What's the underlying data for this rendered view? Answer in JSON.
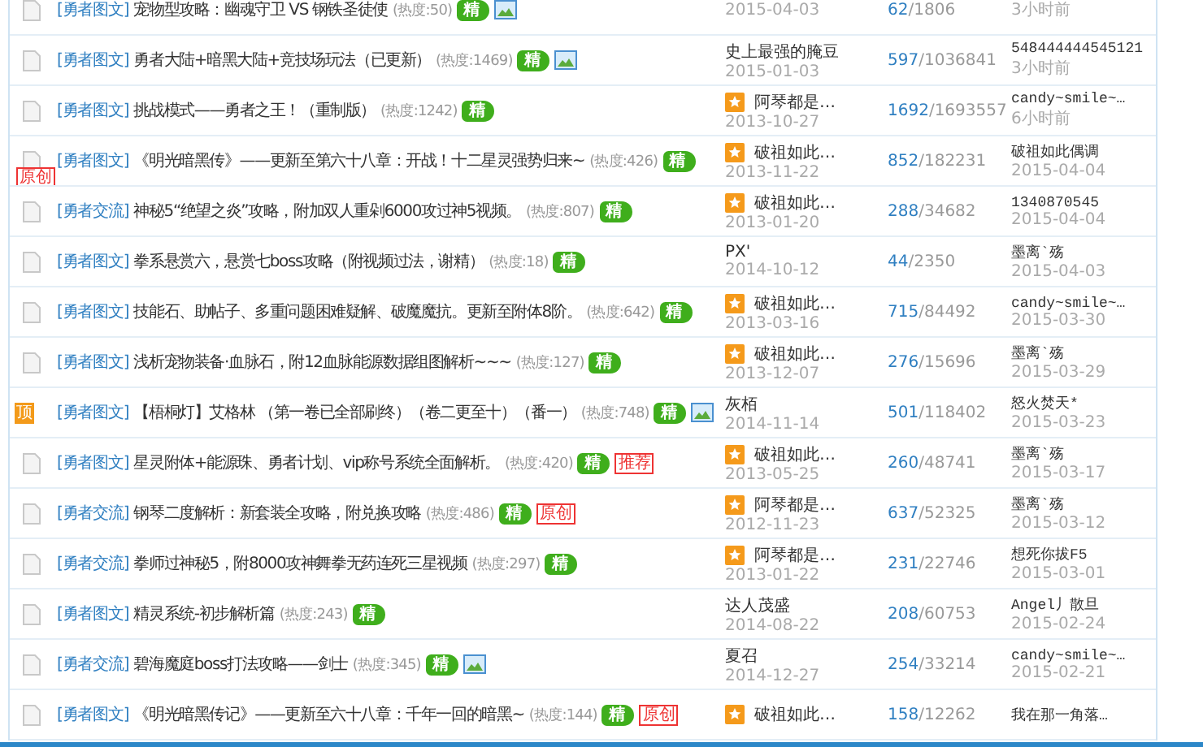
{
  "rows": [
    {
      "icon": {
        "kind": "doc"
      },
      "tag": "[勇者图文]",
      "title": "宠物型攻略：幽魂守卫 VS 钢铁圣徒使",
      "heat": "(热度:50)",
      "badges": [
        {
          "kind": "jing",
          "label": "精"
        },
        {
          "kind": "image"
        }
      ],
      "author": {
        "star": false
      },
      "created": "2015-04-03",
      "replies": "62",
      "views": "/1806",
      "last_time": "3小时前"
    },
    {
      "icon": {
        "kind": "doc"
      },
      "tag": "[勇者图文]",
      "title": "勇者大陆+暗黑大陆+竞技场玩法（已更新）",
      "heat": "(热度:1469)",
      "badges": [
        {
          "kind": "jing",
          "label": "精"
        },
        {
          "kind": "image"
        }
      ],
      "author": {
        "name": "史上最强的腌豆",
        "star": false
      },
      "created": "2015-01-03",
      "replies": "597",
      "views": "/1036841",
      "last_user": "548444444545121",
      "last_time": "3小时前"
    },
    {
      "icon": {
        "kind": "doc"
      },
      "tag": "[勇者图文]",
      "title": "挑战模式——勇者之王！（重制版）",
      "heat": "(热度:1242)",
      "badges": [
        {
          "kind": "jing",
          "label": "精"
        }
      ],
      "author": {
        "name": "阿琴都是…",
        "star": true
      },
      "created": "2013-10-27",
      "replies": "1692",
      "views": "/1693557",
      "last_user": "candy~smile~…",
      "last_time": "6小时前"
    },
    {
      "icon": {
        "kind": "doc"
      },
      "side_stamp": "原创",
      "tag": "[勇者图文]",
      "title": "《明光暗黑传》——更新至第六十八章：开战！十二星灵强势归来~",
      "heat": "(热度:426)",
      "badges": [
        {
          "kind": "jing",
          "label": "精"
        }
      ],
      "author": {
        "name": "破祖如此…",
        "star": true
      },
      "created": "2013-11-22",
      "replies": "852",
      "views": "/182231",
      "last_user": "破祖如此偶调",
      "last_time": "2015-04-04"
    },
    {
      "icon": {
        "kind": "doc"
      },
      "tag": "[勇者交流]",
      "title": "神秘5“绝望之炎”攻略，附加双人重剁6000攻过神5视频。",
      "heat": "(热度:807)",
      "badges": [
        {
          "kind": "jing",
          "label": "精"
        }
      ],
      "author": {
        "name": "破祖如此…",
        "star": true
      },
      "created": "2013-01-20",
      "replies": "288",
      "views": "/34682",
      "last_user": "1340870545",
      "last_time": "2015-04-04"
    },
    {
      "icon": {
        "kind": "doc"
      },
      "tag": "[勇者图文]",
      "title": "拳系悬赏六，悬赏七boss攻略（附视频过法，谢精）",
      "heat": "(热度:18)",
      "badges": [
        {
          "kind": "jing",
          "label": "精"
        }
      ],
      "author": {
        "name": "PX'",
        "star": false
      },
      "created": "2014-10-12",
      "replies": "44",
      "views": "/2350",
      "last_user": "墨离`殇",
      "last_time": "2015-04-03"
    },
    {
      "icon": {
        "kind": "doc"
      },
      "tag": "[勇者图文]",
      "title": "技能石、助帖子、多重问题困难疑解、破魔魔抗。更新至附体8阶。",
      "heat": "(热度:642)",
      "badges": [
        {
          "kind": "jing",
          "label": "精"
        }
      ],
      "author": {
        "name": "破祖如此…",
        "star": true
      },
      "created": "2013-03-16",
      "replies": "715",
      "views": "/84492",
      "last_user": "candy~smile~…",
      "last_time": "2015-03-30"
    },
    {
      "icon": {
        "kind": "doc"
      },
      "tag": "[勇者图文]",
      "title": "浅析宠物装备·血脉石，附12血脉能源数据组图解析~~~",
      "heat": "(热度:127)",
      "badges": [
        {
          "kind": "jing",
          "label": "精"
        }
      ],
      "author": {
        "name": "破祖如此…",
        "star": true
      },
      "created": "2013-12-07",
      "replies": "276",
      "views": "/15696",
      "last_user": "墨离`殇",
      "last_time": "2015-03-29"
    },
    {
      "icon": {
        "kind": "pin",
        "label": "顶"
      },
      "tag": "[勇者图文]",
      "title": "【梧桐灯】艾格林 （第一卷已全部刷终）（卷二更至十）（番一）",
      "heat": "(热度:748)",
      "badges": [
        {
          "kind": "jing",
          "label": "精"
        },
        {
          "kind": "image"
        }
      ],
      "author": {
        "name": "灰栢",
        "star": false
      },
      "created": "2014-11-14",
      "replies": "501",
      "views": "/118402",
      "last_user": "怒火焚天*",
      "last_time": "2015-03-23"
    },
    {
      "icon": {
        "kind": "doc"
      },
      "tag": "[勇者图文]",
      "title": "星灵附体+能源珠、勇者计划、vip称号系统全面解析。",
      "heat": "(热度:420)",
      "badges": [
        {
          "kind": "jing",
          "label": "精"
        },
        {
          "kind": "stamp",
          "label": "推荐"
        }
      ],
      "author": {
        "name": "破祖如此…",
        "star": true
      },
      "created": "2013-05-25",
      "replies": "260",
      "views": "/48741",
      "last_user": "墨离`殇",
      "last_time": "2015-03-17"
    },
    {
      "icon": {
        "kind": "doc"
      },
      "tag": "[勇者交流]",
      "title": "钢琴二度解析：新套装全攻略，附兑换攻略",
      "heat": "(热度:486)",
      "badges": [
        {
          "kind": "jing",
          "label": "精"
        },
        {
          "kind": "stamp",
          "label": "原创"
        }
      ],
      "author": {
        "name": "阿琴都是…",
        "star": true
      },
      "created": "2012-11-23",
      "replies": "637",
      "views": "/52325",
      "last_user": "墨离`殇",
      "last_time": "2015-03-12"
    },
    {
      "icon": {
        "kind": "doc"
      },
      "tag": "[勇者交流]",
      "title": "拳师过神秘5，附8000攻神舞拳无药连死三星视频",
      "heat": "(热度:297)",
      "badges": [
        {
          "kind": "jing",
          "label": "精"
        }
      ],
      "author": {
        "name": "阿琴都是…",
        "star": true
      },
      "created": "2013-01-22",
      "replies": "231",
      "views": "/22746",
      "last_user": "想死你拔F5",
      "last_time": "2015-03-01"
    },
    {
      "icon": {
        "kind": "doc"
      },
      "tag": "[勇者图文]",
      "title": "精灵系统-初步解析篇",
      "heat": "(热度:243)",
      "badges": [
        {
          "kind": "jing",
          "label": "精"
        }
      ],
      "author": {
        "name": "达人茂盛",
        "star": false
      },
      "created": "2014-08-22",
      "replies": "208",
      "views": "/60753",
      "last_user": "Angel丿散旦",
      "last_time": "2015-02-24"
    },
    {
      "icon": {
        "kind": "doc"
      },
      "tag": "[勇者交流]",
      "title": "碧海魔庭boss打法攻略——剑士",
      "heat": "(热度:345)",
      "badges": [
        {
          "kind": "jing",
          "label": "精"
        },
        {
          "kind": "image"
        }
      ],
      "author": {
        "name": "夏召",
        "star": false
      },
      "created": "2014-12-27",
      "replies": "254",
      "views": "/33214",
      "last_user": "candy~smile~…",
      "last_time": "2015-02-21"
    },
    {
      "icon": {
        "kind": "doc"
      },
      "tag": "[勇者图文]",
      "title": "《明光暗黑传记》——更新至六十八章：千年一回的暗黑~",
      "heat": "(热度:144)",
      "badges": [
        {
          "kind": "jing",
          "label": "精"
        },
        {
          "kind": "stamp",
          "label": "原创"
        }
      ],
      "author": {
        "name": "破祖如此…",
        "star": true
      },
      "replies": "158",
      "views": "/12262",
      "last_user": "我在那一角落…"
    }
  ]
}
